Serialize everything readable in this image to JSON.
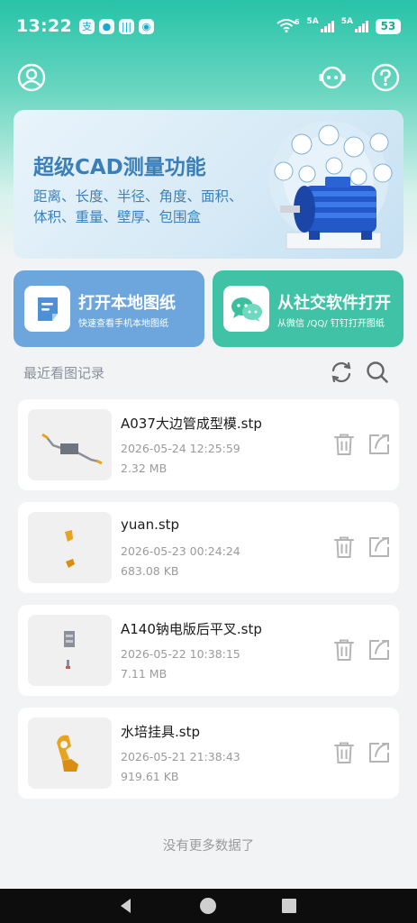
{
  "status_bar": {
    "time": "13:22",
    "net1": "6",
    "net2": "5A",
    "net3": "5A",
    "battery": "53"
  },
  "header": {
    "left_icon": "user-avatar-icon",
    "right_icons": [
      "robot-assistant-icon",
      "help-icon"
    ]
  },
  "banner": {
    "title": "超级CAD测量功能",
    "line1": "距离、长度、半径、角度、面积、",
    "line2": "体积、重量、壁厚、包围盒"
  },
  "actions": [
    {
      "title": "打开本地图纸",
      "subtitle": "快速查看手机本地图纸",
      "color": "#6da6dd",
      "icon": "document-icon"
    },
    {
      "title": "从社交软件打开",
      "subtitle": "从微信 /QQ/ 钉钉打开图纸",
      "color": "#3fc2a5",
      "icon": "chat-bubbles-icon"
    }
  ],
  "recent": {
    "title": "最近看图记录",
    "tools": [
      "refresh-icon",
      "search-icon"
    ]
  },
  "files": [
    {
      "name": "A037大边管成型模.stp",
      "date": "2026-05-24 12:25:59",
      "size": "2.32 MB"
    },
    {
      "name": "yuan.stp",
      "date": "2026-05-23 00:24:24",
      "size": "683.08 KB"
    },
    {
      "name": "A140钠电版后平叉.stp",
      "date": "2026-05-22 10:38:15",
      "size": "7.11 MB"
    },
    {
      "name": "水培挂具.stp",
      "date": "2026-05-21 21:38:43",
      "size": "919.61 KB"
    }
  ],
  "footer": {
    "no_more": "没有更多数据了"
  },
  "colors": {
    "accent": "#27c3a8",
    "banner_text": "#3b7fb8",
    "icon_gray": "#b4b4b4"
  }
}
